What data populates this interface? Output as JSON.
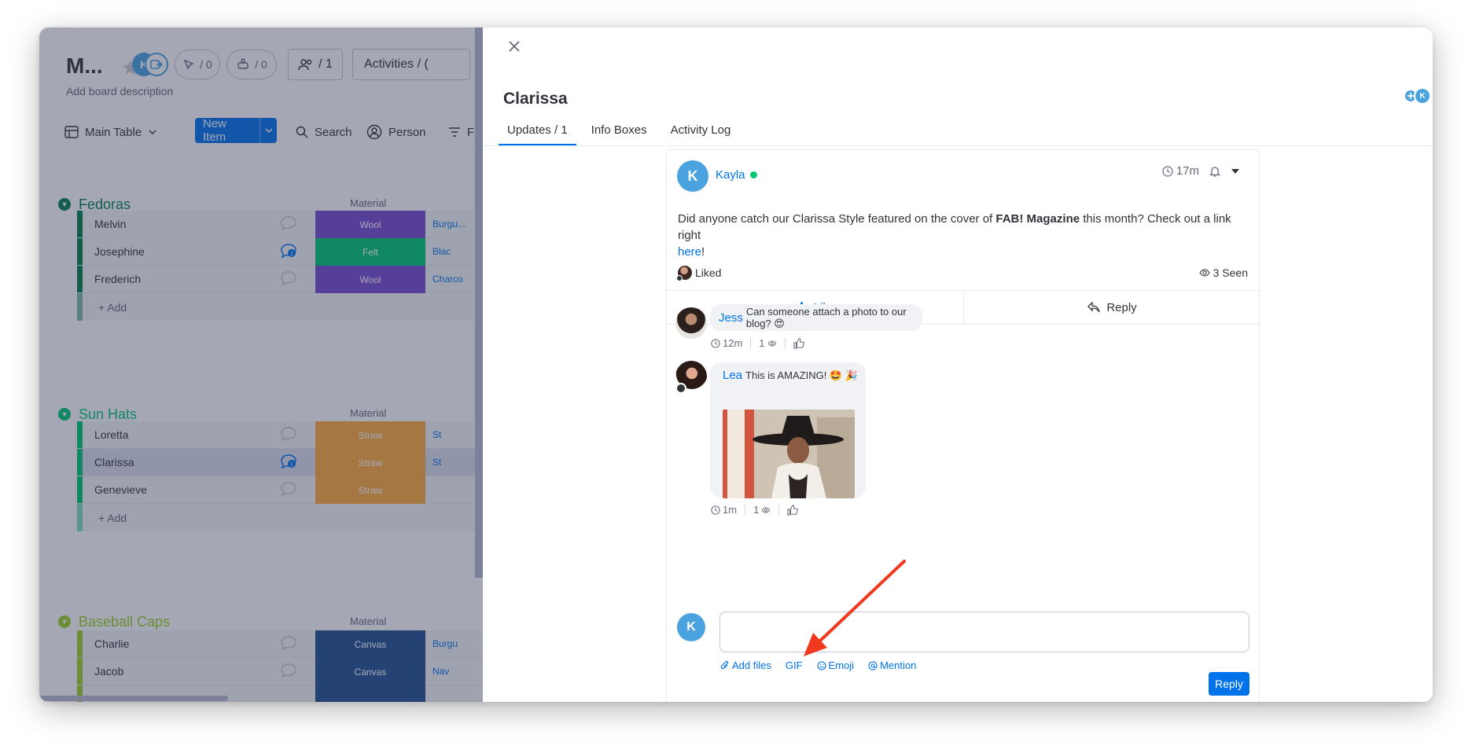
{
  "board": {
    "title": "M...",
    "avatar_initial": "K",
    "automations_count": "/ 0",
    "integrations_count": "/ 0",
    "members_count": "/ 1",
    "activities_label": "Activities / (",
    "description": "Add board description",
    "view_label": "Main Table",
    "new_item_label": "New Item",
    "search_label": "Search",
    "person_label": "Person",
    "filter_label": "F",
    "column_material": "Material",
    "add_label": "+ Add",
    "groups": [
      {
        "name": "Fedoras",
        "color": "#037f4c",
        "rows": [
          {
            "name": "Melvin",
            "status": "Wool",
            "status_color": "#784bd1",
            "tag": "Burgu...",
            "updates": ""
          },
          {
            "name": "Josephine",
            "status": "Felt",
            "status_color": "#00c875",
            "tag": "Blac",
            "updates": "1"
          },
          {
            "name": "Frederich",
            "status": "Wool",
            "status_color": "#784bd1",
            "tag": "Charco",
            "updates": ""
          }
        ]
      },
      {
        "name": "Sun Hats",
        "color": "#00c875",
        "rows": [
          {
            "name": "Loretta",
            "status": "Straw",
            "status_color": "#fdab3d",
            "tag": "St",
            "updates": ""
          },
          {
            "name": "Clarissa",
            "status": "Straw",
            "status_color": "#fdab3d",
            "tag": "St",
            "updates": "1"
          },
          {
            "name": "Genevieve",
            "status": "Straw",
            "status_color": "#fdab3d",
            "tag": "",
            "updates": ""
          }
        ]
      },
      {
        "name": "Baseball Caps",
        "color": "#9cd326",
        "rows": [
          {
            "name": "Charlie",
            "status": "Canvas",
            "status_color": "#225091",
            "tag": "Burgu",
            "updates": ""
          },
          {
            "name": "Jacob",
            "status": "Canvas",
            "status_color": "#225091",
            "tag": "Nav",
            "updates": ""
          }
        ]
      }
    ]
  },
  "panel": {
    "title": "Clarissa",
    "subscriber_initial": "K",
    "tabs": [
      "Updates / 1",
      "Info Boxes",
      "Activity Log"
    ],
    "post": {
      "author": "Kayla",
      "author_initial": "K",
      "time": "17m",
      "body_pre": "Did anyone catch our Clarissa Style featured on the cover of ",
      "body_bold": "FAB! Magazine",
      "body_post": " this month? Check out a link right",
      "body_link": "here",
      "body_end": "!",
      "liked_label": "Liked",
      "seen_label": "3 Seen",
      "like_action": "Like",
      "reply_action": "Reply"
    },
    "replies": [
      {
        "author": "Jess",
        "text": "Can someone attach a photo to our blog? 😍",
        "time": "12m",
        "views": "1"
      },
      {
        "author": "Lea",
        "text": "This is AMAZING! 🤩 🎉",
        "time": "1m",
        "views": "1"
      }
    ],
    "composer": {
      "avatar_initial": "K",
      "add_files": "Add files",
      "gif": "GIF",
      "emoji": "Emoji",
      "mention": "Mention",
      "reply_button": "Reply"
    }
  },
  "colors": {
    "primary": "#0073ea",
    "avatar_blue": "#4aa3df",
    "annotation_arrow": "#f0391f"
  }
}
